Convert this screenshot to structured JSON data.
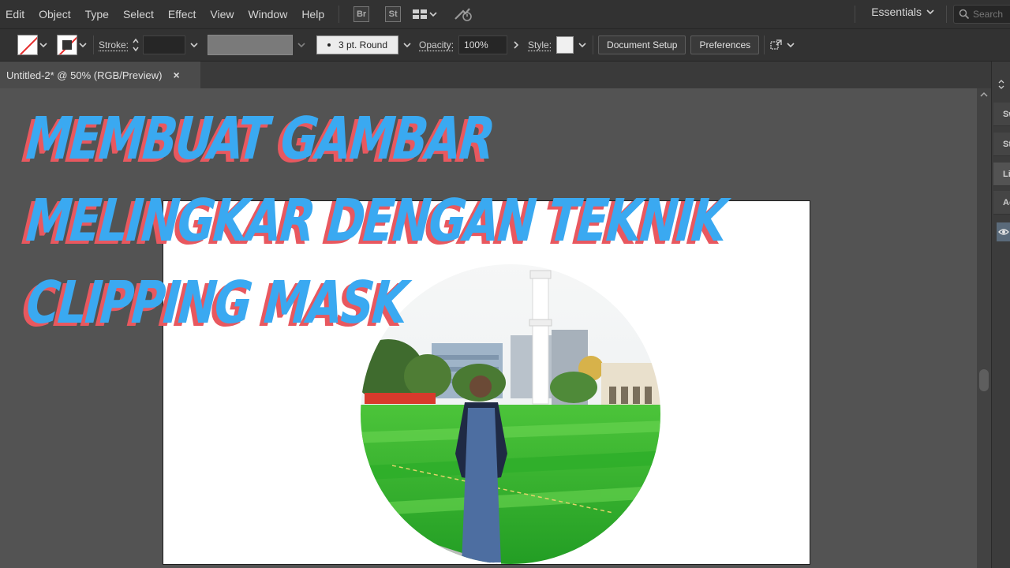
{
  "menu": [
    "Edit",
    "Object",
    "Type",
    "Select",
    "Effect",
    "View",
    "Window",
    "Help"
  ],
  "app_badges": [
    "Br",
    "St"
  ],
  "workspace": {
    "label": "Essentials"
  },
  "search": {
    "placeholder": "Search"
  },
  "controlbar": {
    "stroke_label": "Stroke:",
    "stroke_value": "",
    "brush_value": "3 pt. Round",
    "opacity_label": "Opacity:",
    "opacity_value": "100%",
    "style_label": "Style:",
    "document_setup_label": "Document Setup",
    "preferences_label": "Preferences"
  },
  "document_tab": {
    "title": "Untitled-2* @ 50% (RGB/Preview)",
    "close_glyph": "×"
  },
  "right_panel": {
    "tabs": [
      "Sw",
      "St",
      "Li",
      "Ac"
    ]
  },
  "overlay": {
    "title_lines": [
      "MEMBUAT GAMBAR",
      "MELINGKAR DENGAN TEKNIK",
      "CLIPPING MASK"
    ],
    "shadow_color": "#e8585f",
    "face_color": "#3aa9f1"
  },
  "colors": {
    "ui_dark": "#323232",
    "canvas_bg": "#535353",
    "artboard": "#ffffff",
    "no_fill_slash": "#e52b2b"
  },
  "icons": [
    "chevron-down-icon",
    "stroke-weight-stepper-icon",
    "arrow-right-icon",
    "arrange-documents-icon",
    "gpu-performance-icon",
    "search-icon",
    "transform-icon",
    "eye-icon",
    "close-icon"
  ]
}
